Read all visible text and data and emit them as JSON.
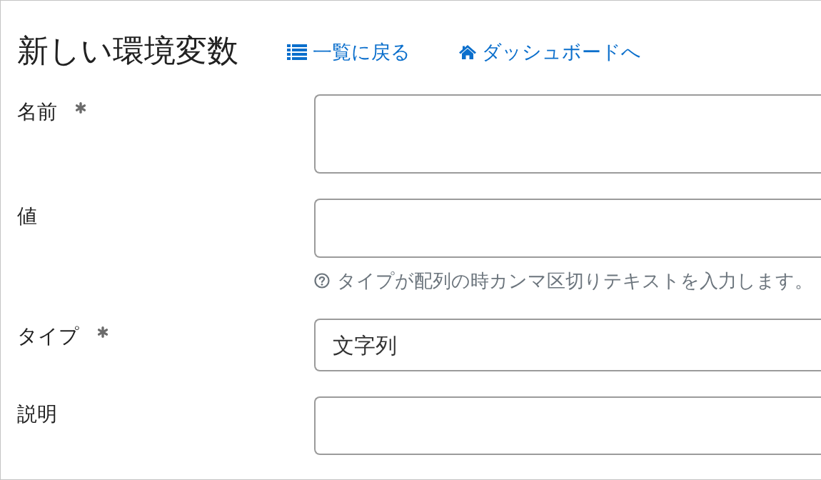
{
  "header": {
    "title": "新しい環境変数",
    "links": [
      {
        "label": "一覧に戻る"
      },
      {
        "label": "ダッシュボードへ"
      }
    ]
  },
  "fields": [
    {
      "label": "名前",
      "required": true,
      "kind": "text"
    },
    {
      "label": "値",
      "required": false,
      "kind": "text",
      "help": "タイプが配列の時カンマ区切りテキストを入力します。"
    },
    {
      "label": "タイプ",
      "required": true,
      "kind": "select",
      "value": "文字列"
    },
    {
      "label": "説明",
      "required": false,
      "kind": "text"
    }
  ]
}
